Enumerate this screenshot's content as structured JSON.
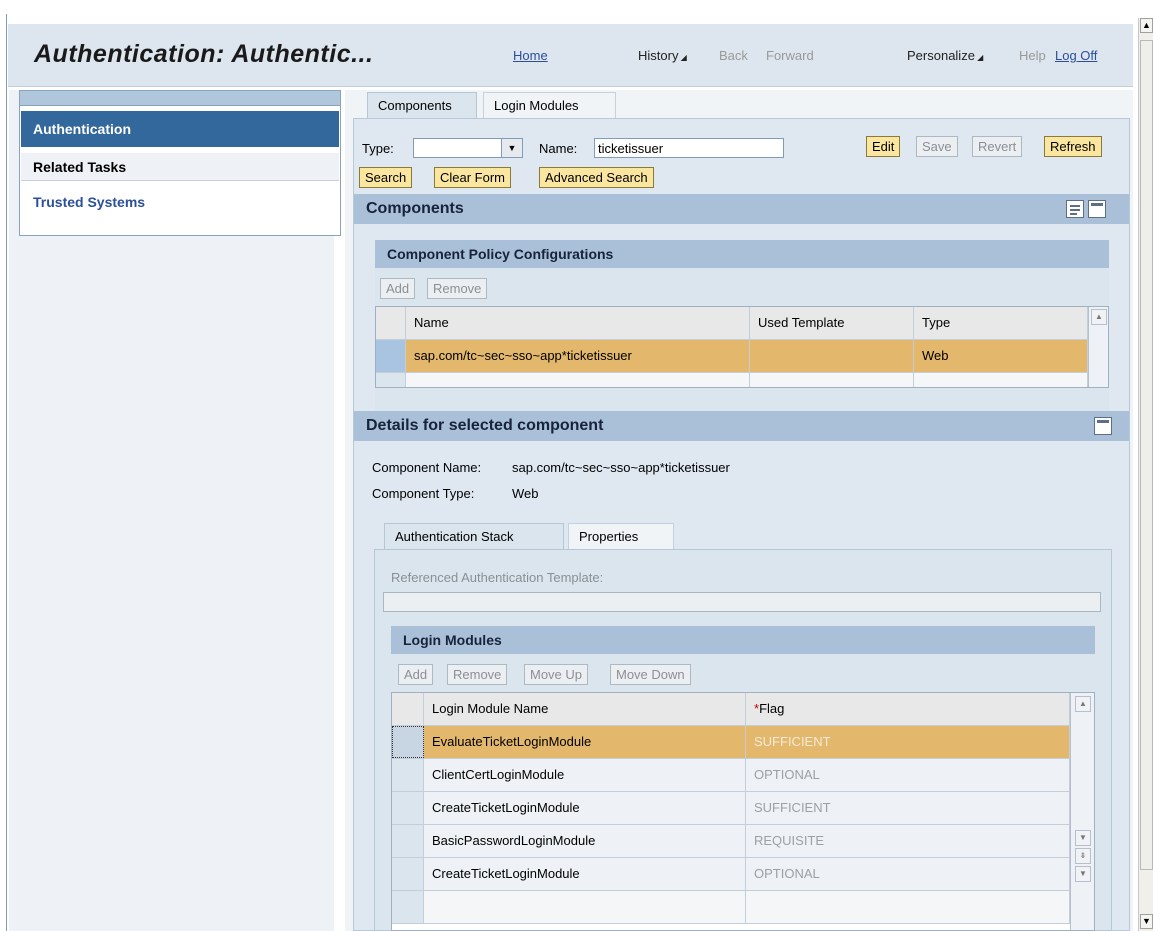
{
  "header": {
    "title": "Authentication: Authentic...",
    "home": "Home",
    "history": "History",
    "back": "Back",
    "forward": "Forward",
    "personalize": "Personalize",
    "help": "Help",
    "logoff": "Log Off"
  },
  "sidebar": {
    "active": "Authentication",
    "related": "Related Tasks",
    "trusted": "Trusted Systems"
  },
  "tabs": [
    "Components",
    "Login Modules"
  ],
  "search": {
    "type_label": "Type:",
    "type_value": "",
    "name_label": "Name:",
    "name_value": "ticketissuer",
    "edit": "Edit",
    "save": "Save",
    "revert": "Revert",
    "refresh": "Refresh",
    "search": "Search",
    "clear": "Clear Form",
    "advanced": "Advanced Search"
  },
  "components": {
    "section_title": "Components",
    "policy_title": "Component Policy Configurations",
    "add": "Add",
    "remove": "Remove",
    "columns": [
      "Name",
      "Used Template",
      "Type"
    ],
    "rows": [
      {
        "name": "sap.com/tc~sec~sso~app*ticketissuer",
        "template": "",
        "type": "Web"
      }
    ]
  },
  "details": {
    "section_title": "Details for selected component",
    "comp_name_label": "Component Name:",
    "comp_name": "sap.com/tc~sec~sso~app*ticketissuer",
    "comp_type_label": "Component Type:",
    "comp_type": "Web",
    "tabs": [
      "Authentication Stack",
      "Properties"
    ],
    "ref_template_label": "Referenced Authentication Template:",
    "ref_template_value": "",
    "login_modules_title": "Login Modules",
    "add": "Add",
    "remove": "Remove",
    "move_up": "Move Up",
    "move_down": "Move Down",
    "columns": [
      "Login Module Name",
      "*Flag"
    ],
    "rows": [
      {
        "name": "EvaluateTicketLoginModule",
        "flag": "SUFFICIENT"
      },
      {
        "name": "ClientCertLoginModule",
        "flag": "OPTIONAL"
      },
      {
        "name": "CreateTicketLoginModule",
        "flag": "SUFFICIENT"
      },
      {
        "name": "BasicPasswordLoginModule",
        "flag": "REQUISITE"
      },
      {
        "name": "CreateTicketLoginModule",
        "flag": "OPTIONAL"
      }
    ]
  }
}
